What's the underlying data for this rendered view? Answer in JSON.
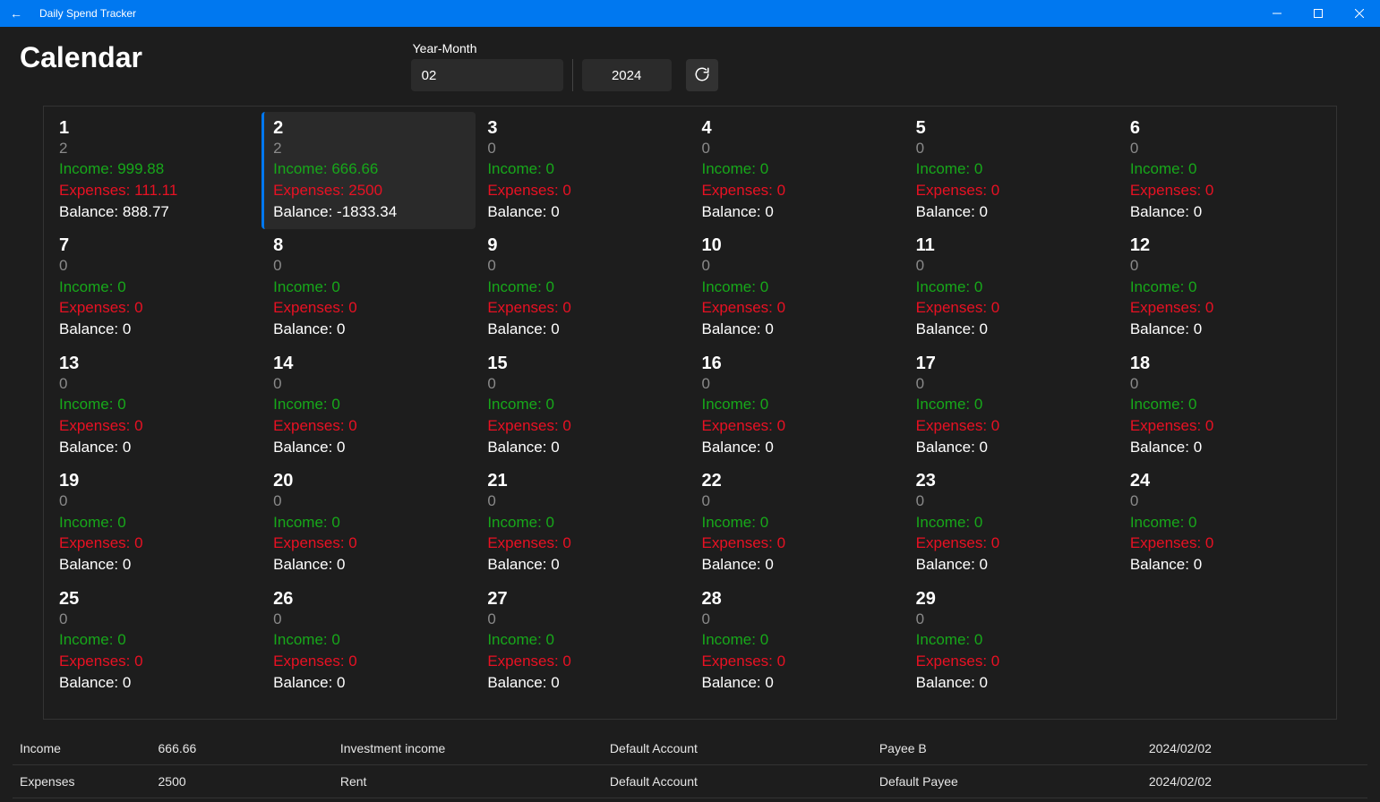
{
  "window": {
    "title": "Daily Spend Tracker"
  },
  "page": {
    "title": "Calendar",
    "year_month_label": "Year-Month",
    "month_value": "02",
    "year_value": "2024"
  },
  "labels": {
    "income_prefix": "Income: ",
    "expense_prefix": "Expenses: ",
    "balance_prefix": "Balance: "
  },
  "calendar": {
    "selected_day": 2,
    "days": [
      {
        "day": "1",
        "count": "2",
        "income": "999.88",
        "expenses": "111.11",
        "balance": "888.77"
      },
      {
        "day": "2",
        "count": "2",
        "income": "666.66",
        "expenses": "2500",
        "balance": "-1833.34"
      },
      {
        "day": "3",
        "count": "0",
        "income": "0",
        "expenses": "0",
        "balance": "0"
      },
      {
        "day": "4",
        "count": "0",
        "income": "0",
        "expenses": "0",
        "balance": "0"
      },
      {
        "day": "5",
        "count": "0",
        "income": "0",
        "expenses": "0",
        "balance": "0"
      },
      {
        "day": "6",
        "count": "0",
        "income": "0",
        "expenses": "0",
        "balance": "0"
      },
      {
        "day": "7",
        "count": "0",
        "income": "0",
        "expenses": "0",
        "balance": "0"
      },
      {
        "day": "8",
        "count": "0",
        "income": "0",
        "expenses": "0",
        "balance": "0"
      },
      {
        "day": "9",
        "count": "0",
        "income": "0",
        "expenses": "0",
        "balance": "0"
      },
      {
        "day": "10",
        "count": "0",
        "income": "0",
        "expenses": "0",
        "balance": "0"
      },
      {
        "day": "11",
        "count": "0",
        "income": "0",
        "expenses": "0",
        "balance": "0"
      },
      {
        "day": "12",
        "count": "0",
        "income": "0",
        "expenses": "0",
        "balance": "0"
      },
      {
        "day": "13",
        "count": "0",
        "income": "0",
        "expenses": "0",
        "balance": "0"
      },
      {
        "day": "14",
        "count": "0",
        "income": "0",
        "expenses": "0",
        "balance": "0"
      },
      {
        "day": "15",
        "count": "0",
        "income": "0",
        "expenses": "0",
        "balance": "0"
      },
      {
        "day": "16",
        "count": "0",
        "income": "0",
        "expenses": "0",
        "balance": "0"
      },
      {
        "day": "17",
        "count": "0",
        "income": "0",
        "expenses": "0",
        "balance": "0"
      },
      {
        "day": "18",
        "count": "0",
        "income": "0",
        "expenses": "0",
        "balance": "0"
      },
      {
        "day": "19",
        "count": "0",
        "income": "0",
        "expenses": "0",
        "balance": "0"
      },
      {
        "day": "20",
        "count": "0",
        "income": "0",
        "expenses": "0",
        "balance": "0"
      },
      {
        "day": "21",
        "count": "0",
        "income": "0",
        "expenses": "0",
        "balance": "0"
      },
      {
        "day": "22",
        "count": "0",
        "income": "0",
        "expenses": "0",
        "balance": "0"
      },
      {
        "day": "23",
        "count": "0",
        "income": "0",
        "expenses": "0",
        "balance": "0"
      },
      {
        "day": "24",
        "count": "0",
        "income": "0",
        "expenses": "0",
        "balance": "0"
      },
      {
        "day": "25",
        "count": "0",
        "income": "0",
        "expenses": "0",
        "balance": "0"
      },
      {
        "day": "26",
        "count": "0",
        "income": "0",
        "expenses": "0",
        "balance": "0"
      },
      {
        "day": "27",
        "count": "0",
        "income": "0",
        "expenses": "0",
        "balance": "0"
      },
      {
        "day": "28",
        "count": "0",
        "income": "0",
        "expenses": "0",
        "balance": "0"
      },
      {
        "day": "29",
        "count": "0",
        "income": "0",
        "expenses": "0",
        "balance": "0"
      }
    ]
  },
  "transactions": [
    {
      "type": "Income",
      "amount": "666.66",
      "category": "Investment income",
      "account": "Default Account",
      "payee": "Payee B",
      "date": "2024/02/02"
    },
    {
      "type": "Expenses",
      "amount": "2500",
      "category": "Rent",
      "account": "Default Account",
      "payee": "Default Payee",
      "date": "2024/02/02"
    }
  ]
}
